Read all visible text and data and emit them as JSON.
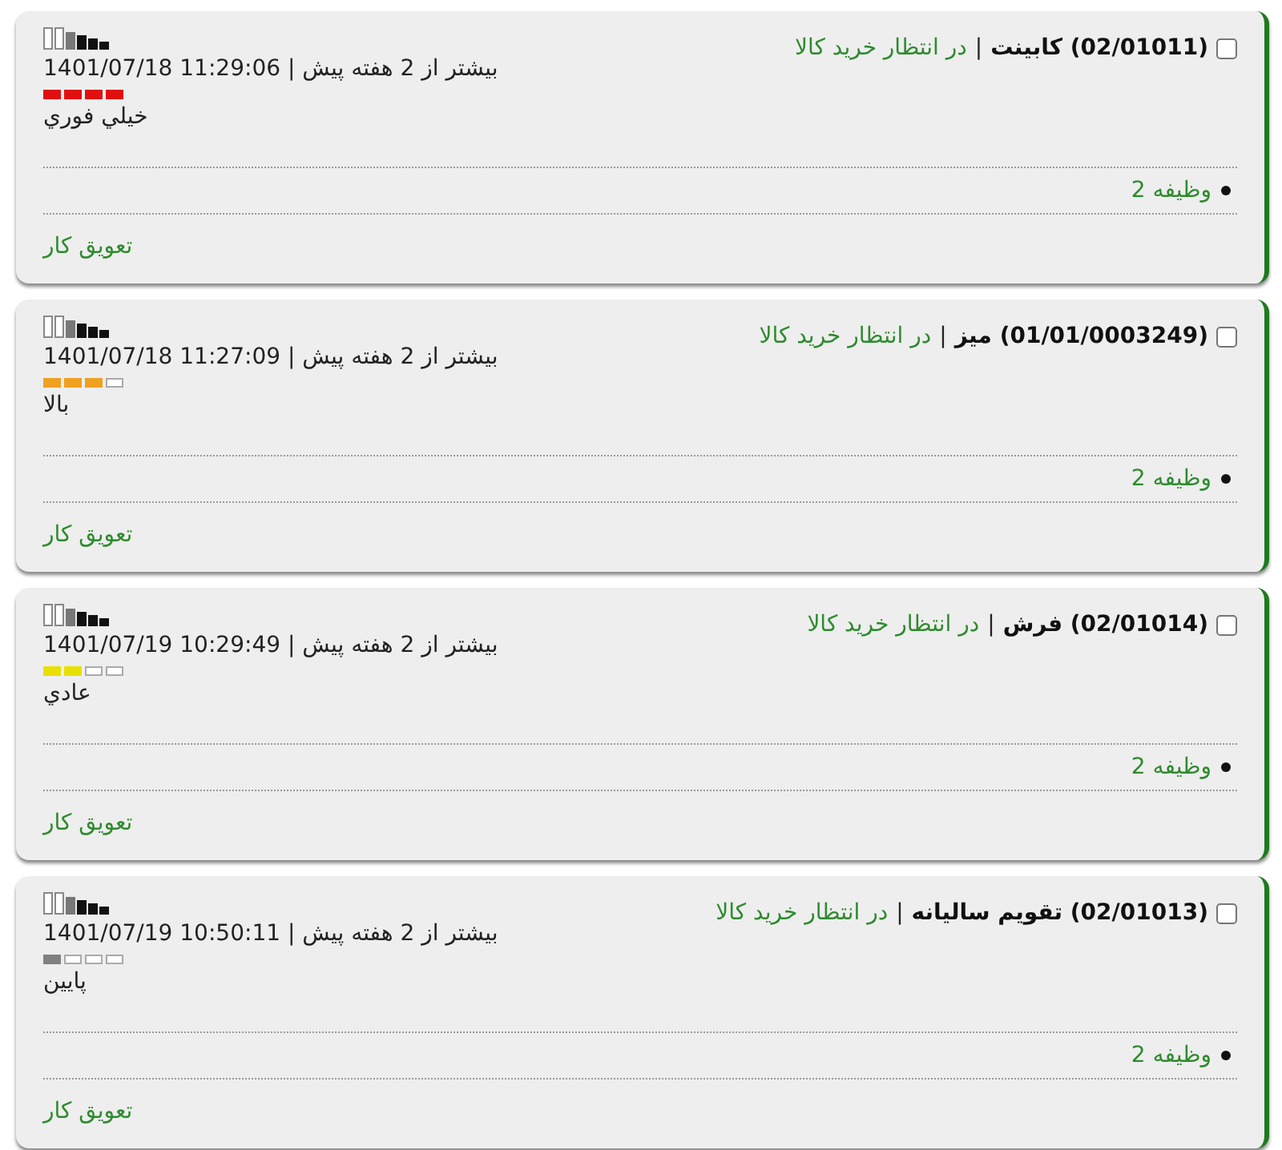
{
  "cards": [
    {
      "checked": false,
      "code": "(02/01011)",
      "name": "کابینت",
      "separator": "|",
      "status": "در انتظار خرید کالا",
      "relative_time": "بیشتر از 2 هفته پیش",
      "timestamp": "1401/07/18 11:29:06",
      "priority": {
        "stars": 4,
        "color": "#e01010",
        "label": "خيلي فوري"
      },
      "tasks": [
        {
          "label": "وظیفه 2"
        }
      ],
      "action": "تعویق کار"
    },
    {
      "checked": false,
      "code": "(01/01/0003249)",
      "name": "میز",
      "separator": "|",
      "status": "در انتظار خرید کالا",
      "relative_time": "بیشتر از 2 هفته پیش",
      "timestamp": "1401/07/18 11:27:09",
      "priority": {
        "stars": 3,
        "color": "#f0a020",
        "label": "بالا"
      },
      "tasks": [
        {
          "label": "وظیفه 2"
        }
      ],
      "action": "تعویق کار"
    },
    {
      "checked": false,
      "code": "(02/01014)",
      "name": "فرش",
      "separator": "|",
      "status": "در انتظار خرید کالا",
      "relative_time": "بیشتر از 2 هفته پیش",
      "timestamp": "1401/07/19 10:29:49",
      "priority": {
        "stars": 2,
        "color": "#e8e000",
        "label": "عادي"
      },
      "tasks": [
        {
          "label": "وظیفه 2"
        }
      ],
      "action": "تعویق کار"
    },
    {
      "checked": false,
      "code": "(02/01013)",
      "name": "تقویم سالیانه",
      "separator": "|",
      "status": "در انتظار خرید کالا",
      "relative_time": "بیشتر از 2 هفته پیش",
      "timestamp": "1401/07/19 10:50:11",
      "priority": {
        "stars": 1,
        "color": "#808080",
        "label": "پایین"
      },
      "tasks": [
        {
          "label": "وظیفه 2"
        }
      ],
      "action": "تعویق کار"
    }
  ]
}
